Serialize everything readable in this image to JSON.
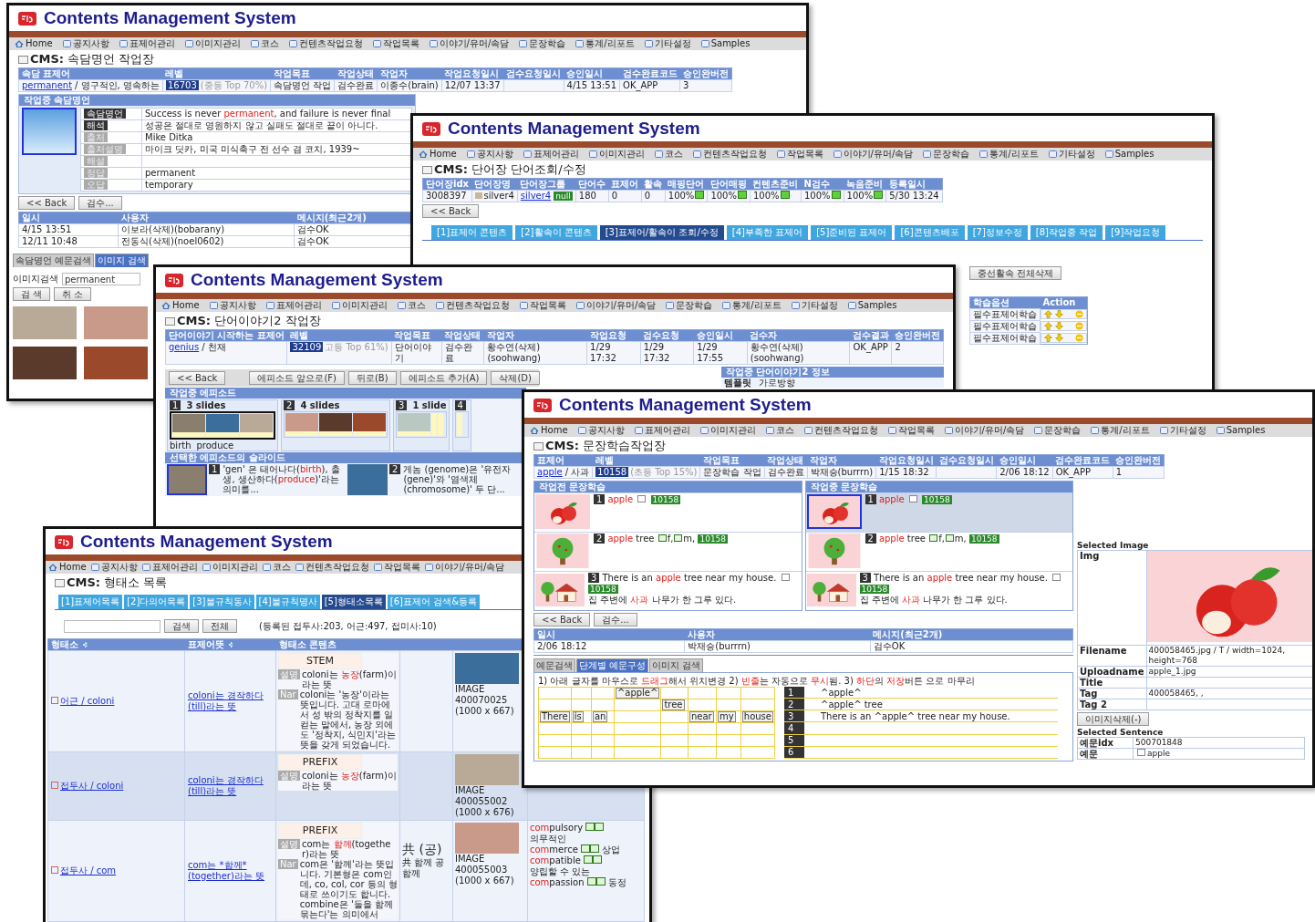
{
  "windows": [
    {
      "kind": "proverb",
      "title": "Contents Management System",
      "nav": [
        "Home",
        "공지사항",
        "표제어관리",
        "이미지관리",
        "코스",
        "컨텐츠작업요청",
        "작업목록",
        "이야기/유머/속담",
        "문장학습",
        "통계/리포트",
        "기타설정",
        "Samples"
      ],
      "page_title": "**CMS:** 속담명언 작업장",
      "summary": {
        "columns": [
          "속담 표제어",
          "레벨",
          "작업목표",
          "작업상태",
          "작업자",
          "작업요청일시",
          "검수요청일시",
          "승인일시",
          "검수완료코드",
          "승인완버전"
        ],
        "row": {
          "link": "permanent",
          "meaning": "/ 영구적인, 영속하는",
          "badge": "16703",
          "note": "(중등 Top 70%)",
          "cells": [
            "속담명언 작업",
            "검수완료",
            "이종수(brain)",
            "12/07 13:37",
            {
              "kind": "blank"
            },
            "4/15 13:51",
            "OK_APP",
            "3"
          ]
        }
      },
      "panel": {
        "header": "작업중 속담명언",
        "fields": [
          {
            "label": "속담명언",
            "active": true,
            "value": [
              {
                "text": "Success is never ",
                "red": false
              },
              {
                "text": "permanent",
                "red": true
              },
              {
                "text": ", and failure is never final",
                "red": false
              }
            ]
          },
          {
            "label": "해석",
            "active": true,
            "value": [
              {
                "text": "성공은 절대로 영원하지 않고 실패도 절대로 끝이 아니다.",
                "red": false
              }
            ]
          },
          {
            "label": "출처",
            "active": false,
            "value": [
              {
                "text": "Mike Ditka",
                "red": false
              }
            ]
          },
          {
            "label": "출처설명",
            "active": false,
            "value": [
              {
                "text": "마이크 딧카, 미국 미식축구 전 선수 겸 코치, 1939~",
                "red": false
              }
            ]
          },
          {
            "label": "해설",
            "active": false
          },
          {
            "label": "정답",
            "active": false,
            "value": [
              {
                "text": "permanent",
                "red": false
              }
            ]
          },
          {
            "label": "오답",
            "active": false,
            "value": [
              {
                "text": "temporary",
                "red": false
              }
            ]
          }
        ]
      },
      "buttons": [
        "<< Back",
        "검수..."
      ],
      "log": {
        "columns": [
          "일시",
          "사용자",
          "메시지(최근2개)"
        ],
        "rows": [
          [
            "4/15 13:51",
            "이보라(삭제)(bobarany)",
            "검수OK"
          ],
          [
            "12/11 10:48",
            "전동식(삭제)(noel0602)",
            "검수OK"
          ]
        ]
      },
      "tabs": [
        {
          "label": "속담명언 예문검색",
          "selected": false
        },
        {
          "label": "이미지 검색",
          "selected": true
        }
      ],
      "image_search": {
        "label": "이미지검색",
        "value": "permanent",
        "buttons": [
          "검 색",
          "취 소"
        ]
      }
    },
    {
      "kind": "wordbook",
      "title": "Contents Management System",
      "nav": [
        "Home",
        "공지사항",
        "표제어관리",
        "이미지관리",
        "코스",
        "컨텐츠작업요청",
        "작업목록",
        "이야기/유머/속담",
        "문장학습",
        "통계/리포트",
        "기타설정",
        "Samples"
      ],
      "page_title": "**CMS:** 단어장 단어조회/수정",
      "table": {
        "columns": [
          "단어장idx",
          "단어장명",
          "단어장그룹",
          "단어수",
          "표제어",
          "활속",
          "매핑단어",
          "단어매핑",
          "컨텐츠준비",
          "N검수",
          "녹음준비",
          "등록일시"
        ],
        "row": {
          "idx": "3008397",
          "name": "silver4",
          "group": "silver4",
          "group_tag": "null",
          "cells": [
            "180",
            "0",
            "0"
          ],
          "percents": [
            "100%",
            "100%",
            "100%",
            "100%",
            "100%"
          ],
          "date": "5/30 13:24"
        }
      },
      "back": "<< Back",
      "tabs": [
        {
          "label": "[1]표제어 콘텐츠",
          "selected": false
        },
        {
          "label": "[2]활속이 콘텐츠",
          "selected": false
        },
        {
          "label": "[3]표제어/활속이 조회/수정",
          "selected": true
        },
        {
          "label": "[4]부족한 표제어",
          "selected": false
        },
        {
          "label": "[5]준비된 표제어",
          "selected": false
        },
        {
          "label": "[6]콘텐츠배포",
          "selected": false
        },
        {
          "label": "[7]정보수정",
          "selected": false
        },
        {
          "label": "[8]작업중 작업",
          "selected": false
        },
        {
          "label": "[9]작업요청",
          "selected": false
        }
      ],
      "extra_button": "중선활속 전체삭제",
      "options": {
        "columns": [
          "학습옵션",
          "Action"
        ],
        "rows": [
          "필수표제어학습",
          "필수표제어학습",
          "필수표제어학습"
        ]
      }
    },
    {
      "kind": "story",
      "title": "Contents Management System",
      "nav": [
        "Home",
        "공지사항",
        "표제어관리",
        "이미지관리",
        "코스",
        "컨텐츠작업요청",
        "작업목록",
        "이야기/유머/속담",
        "문장학습",
        "통계/리포트",
        "기타설정",
        "Samples"
      ],
      "page_title": "**CMS:** 단어이야기2 작업장",
      "summary": {
        "columns": [
          "단어이야기 시작하는 표제어",
          "레벨",
          "작업목표",
          "작업상태",
          "작업자",
          "작업요청",
          "검수요청",
          "승인일시",
          "검수자",
          "검수결과",
          "승인완버전"
        ],
        "row": {
          "link": "genius",
          "meaning": "/ 천재",
          "badge": "32109",
          "note": "고등 Top 61%)",
          "cells": [
            "단어이야기",
            "검수완료",
            "황수연(삭제)(soohwang)",
            "1/29 17:32",
            "1/29 17:32",
            "1/29 17:55",
            "황수연(삭제)(soohwang)",
            "OK_APP",
            "2"
          ]
        }
      },
      "toolbar": [
        "<< Back",
        "에피소드 앞으로(F)",
        "뒤로(B)",
        "에피소드 추가(A)",
        "삭제(D)"
      ],
      "info": {
        "header": "작업중 단어이야기2 정보",
        "label": "템플릿",
        "value": "가로방향"
      },
      "episodes_header": "작업중 에피소드",
      "episodes": [
        {
          "num": "1",
          "count": "3 slides",
          "selected": true,
          "slides": [
            {
              "kind": "photo"
            },
            {
              "kind": "photo"
            },
            {
              "kind": "photo"
            }
          ],
          "words": [
            "birth",
            "produce"
          ]
        },
        {
          "num": "2",
          "count": "4 slides",
          "selected": false,
          "slides": [
            {
              "kind": "photo"
            },
            {
              "kind": "photo"
            },
            {
              "kind": "photo"
            }
          ]
        },
        {
          "num": "3",
          "count": "1 slide",
          "selected": false,
          "slides": [
            {
              "kind": "photo"
            },
            {
              "kind": "blank"
            },
            {
              "kind": "blank"
            }
          ]
        },
        {
          "num": "4",
          "selected": false,
          "slides": [
            {
              "kind": "blank"
            }
          ]
        }
      ],
      "slides_header": "선택한 에피소드의 슬라이드",
      "slides": [
        {
          "num": "1",
          "parts": [
            {
              "text": "'gen' 은 태어나다(",
              "red": false
            },
            {
              "text": "birth",
              "red": true
            },
            {
              "text": "), 출생, 생산하다(",
              "red": false
            },
            {
              "text": "produce",
              "red": true
            },
            {
              "text": ")'라는 의미를...",
              "red": false
            }
          ]
        },
        {
          "num": "2",
          "parts": [
            {
              "text": "게놈 (genome)은 '유전자(gene)'와 '염색체(chromosome)' 두 단...",
              "red": false
            }
          ]
        }
      ]
    },
    {
      "kind": "sentence",
      "title": "Contents Management System",
      "nav": [
        "Home",
        "공지사항",
        "표제어관리",
        "이미지관리",
        "코스",
        "컨텐츠작업요청",
        "작업목록",
        "이야기/유머/속담",
        "문장학습",
        "통계/리포트",
        "기타설정",
        "Samples"
      ],
      "page_title": "**CMS:** 문장학습작업장",
      "summary": {
        "columns": [
          "표제어",
          "레벨",
          "작업목표",
          "작업상태",
          "작업자",
          "작업요청일시",
          "검수요청일시",
          "승인일시",
          "검수완료코드",
          "승인완버전"
        ],
        "row": {
          "link": "apple",
          "meaning": "/ 사과",
          "badge": "10158",
          "note": "(초등 Top 15%)",
          "cells": [
            "문장학습 작업",
            "검수완료",
            "박재승(burrrn)",
            "1/15 18:32",
            {
              "kind": "blank"
            },
            "2/06 18:12",
            "OK_APP",
            "1"
          ]
        }
      },
      "panels": [
        {
          "header": "작업전 문장학습",
          "items": [
            {
              "num": "1",
              "picture": {
                "kind": "apple"
              },
              "kind": "image",
              "en": [
                {
                  "text": "apple",
                  "red": true
                }
              ],
              "grade": "10158",
              "selected": false
            },
            {
              "num": "2",
              "picture": {
                "kind": "tree"
              },
              "kind": "audio",
              "en": [
                {
                  "text": "apple",
                  "red": true
                },
                {
                  "text": " tree",
                  "red": false
                }
              ],
              "audio": [
                "f,",
                "m,"
              ],
              "grade": "10158",
              "selected": false
            },
            {
              "num": "3",
              "picture": {
                "kind": "house"
              },
              "kind": "image",
              "en": [
                {
                  "text": "There is an ",
                  "red": false
                },
                {
                  "text": "apple",
                  "red": true
                },
                {
                  "text": " tree near my house.",
                  "red": false
                }
              ],
              "ko": [
                {
                  "text": "집 주변에 ",
                  "red": false
                },
                {
                  "text": "사과",
                  "red": true
                },
                {
                  "text": " 나무가 한 그루 있다.",
                  "red": false
                }
              ],
              "grade": "10158",
              "selected": false
            }
          ]
        },
        {
          "header": "작업중 문장학습",
          "items": [
            {
              "num": "1",
              "picture": {
                "kind": "apple"
              },
              "kind": "image",
              "en": [
                {
                  "text": "apple",
                  "red": true
                }
              ],
              "grade": "10158",
              "selected": true
            },
            {
              "num": "2",
              "picture": {
                "kind": "tree"
              },
              "kind": "audio",
              "en": [
                {
                  "text": "apple",
                  "red": true
                },
                {
                  "text": " tree",
                  "red": false
                }
              ],
              "audio": [
                "f,",
                "m,"
              ],
              "grade": "10158",
              "selected": false
            },
            {
              "num": "3",
              "picture": {
                "kind": "house"
              },
              "kind": "image",
              "en": [
                {
                  "text": "There is an ",
                  "red": false
                },
                {
                  "text": "apple",
                  "red": true
                },
                {
                  "text": " tree near my house.",
                  "red": false
                }
              ],
              "ko": [
                {
                  "text": "집 주변에 ",
                  "red": false
                },
                {
                  "text": "사과",
                  "red": true
                },
                {
                  "text": " 나무가 한 그루 있다.",
                  "red": false
                }
              ],
              "grade": "10158",
              "selected": false
            }
          ]
        }
      ],
      "buttons": [
        "<< Back",
        "검수..."
      ],
      "log": {
        "columns": [
          "일시",
          "사용자",
          "메시지(최근2개)"
        ],
        "rows": [
          [
            "2/06 18:12",
            "박재승(burrrn)",
            "검수OK"
          ]
        ]
      },
      "tabs": [
        {
          "label": "예문검색",
          "selected": false
        },
        {
          "label": "단계별 예문구성",
          "selected": true
        },
        {
          "label": "이미지 검색",
          "selected": false
        }
      ],
      "instruction": [
        {
          "text": "1) 아래 글자를 마우스로 ",
          "red": false
        },
        {
          "text": "드래그",
          "red": true
        },
        {
          "text": "해서 위치변경    2) ",
          "red": false
        },
        {
          "text": "빈줄",
          "red": true
        },
        {
          "text": "는 자동으로 ",
          "red": false
        },
        {
          "text": "무시",
          "red": true
        },
        {
          "text": "됨.    3) ",
          "red": false
        },
        {
          "text": "하단",
          "red": true
        },
        {
          "text": "의 ",
          "red": false
        },
        {
          "text": "저장",
          "red": true
        },
        {
          "text": "버튼 으로 마무리",
          "red": false
        }
      ],
      "grid": [
        [
          {
            "kind": "empty"
          },
          {
            "kind": "empty"
          },
          {
            "kind": "empty"
          },
          {
            "kind": "word",
            "word": "^apple^"
          },
          {
            "kind": "empty"
          },
          {
            "kind": "empty"
          },
          {
            "kind": "empty"
          },
          {
            "kind": "empty"
          }
        ],
        [
          {
            "kind": "empty"
          },
          {
            "kind": "empty"
          },
          {
            "kind": "empty"
          },
          {
            "kind": "empty"
          },
          {
            "kind": "word",
            "word": "tree"
          },
          {
            "kind": "empty"
          },
          {
            "kind": "empty"
          },
          {
            "kind": "empty"
          }
        ],
        [
          {
            "kind": "word",
            "word": "There"
          },
          {
            "kind": "word",
            "word": "is"
          },
          {
            "kind": "word",
            "word": "an"
          },
          {
            "kind": "empty"
          },
          {
            "kind": "empty"
          },
          {
            "kind": "word",
            "word": "near"
          },
          {
            "kind": "word",
            "word": "my"
          },
          {
            "kind": "word",
            "word": "house"
          }
        ],
        [
          {
            "kind": "empty"
          },
          {
            "kind": "empty"
          },
          {
            "kind": "empty"
          },
          {
            "kind": "empty"
          },
          {
            "kind": "empty"
          },
          {
            "kind": "empty"
          },
          {
            "kind": "empty"
          },
          {
            "kind": "empty"
          }
        ],
        [
          {
            "kind": "empty"
          },
          {
            "kind": "empty"
          },
          {
            "kind": "empty"
          },
          {
            "kind": "empty"
          },
          {
            "kind": "empty"
          },
          {
            "kind": "empty"
          },
          {
            "kind": "empty"
          },
          {
            "kind": "empty"
          }
        ],
        [
          {
            "kind": "empty"
          },
          {
            "kind": "empty"
          },
          {
            "kind": "empty"
          },
          {
            "kind": "empty"
          },
          {
            "kind": "empty"
          },
          {
            "kind": "empty"
          },
          {
            "kind": "empty"
          },
          {
            "kind": "empty"
          }
        ]
      ],
      "sentences": [
        {
          "num": "1",
          "text": "^apple^"
        },
        {
          "num": "2",
          "text": "^apple^ tree"
        },
        {
          "num": "3",
          "text": "There is an ^apple^ tree near my house."
        },
        {
          "num": "4"
        },
        {
          "num": "5"
        },
        {
          "num": "6"
        }
      ],
      "selected_image": {
        "title": "Selected Image",
        "img_label": "Img",
        "fields": [
          {
            "label": "Filename",
            "value": "400058465.jpg / T / width=1024, height=768"
          },
          {
            "label": "Uploadname",
            "value": "apple_1.jpg"
          },
          {
            "label": "Title"
          },
          {
            "label": "Tag",
            "value": "400058465, ,"
          },
          {
            "label": "Tag 2"
          }
        ],
        "button": "이미지삭제(-)"
      },
      "selected_sentence": {
        "title": "Selected Sentence",
        "fields": [
          {
            "label": "예문idx",
            "value": "500701848"
          },
          {
            "label": "예문",
            "value": "apple"
          }
        ]
      }
    },
    {
      "kind": "morpheme",
      "title": "Contents Management System",
      "nav": [
        "Home",
        "공지사항",
        "표제어관리",
        "이미지관리",
        "코스",
        "컨텐츠작업요청",
        "작업목록",
        "이야기/유머/속담"
      ],
      "page_title": "**CMS:** 형태소 목록",
      "tabs": [
        {
          "label": "[1]표제어목록",
          "selected": false
        },
        {
          "label": "[2]다의어목록",
          "selected": false
        },
        {
          "label": "[3]불규칙동사",
          "selected": false
        },
        {
          "label": "[4]불규칙명사",
          "selected": false
        },
        {
          "label": "[5]형태소목록",
          "selected": true
        },
        {
          "label": "[6]표제어 검색&등록",
          "selected": false
        }
      ],
      "search": {
        "buttons": [
          "검색",
          "전체"
        ],
        "stats": "(등록된 접두사:203, 어근:497, 접미사:10)"
      },
      "table": {
        "columns": [
          "형태소",
          "표제어뜻",
          "형태소 콘텐츠"
        ],
        "rows": [
          {
            "morpheme": "어근 / coloni",
            "meaning": "coloni는 경작하다(till)라는 뜻",
            "type": "STEM",
            "desc_label": "설명",
            "desc": [
              {
                "text": "coloni는 ",
                "red": false
              },
              {
                "text": "농장",
                "red": true
              },
              {
                "text": "(farm)이라는 뜻",
                "red": false
              }
            ],
            "nar_label": "Nar",
            "nar": "coloni는 '농장'이라는 뜻입니다. 고대 로마에서 성 밖의 정착지를 일컫는 말에서, 농장 외에도 '정착지, 식민지'라는 뜻을 갖게 되었습니다.",
            "image": [
              "IMAGE",
              "400070025",
              "(1000 x 667)"
            ],
            "selected": false
          },
          {
            "morpheme": "접두사 / coloni",
            "meaning": "coloni는 경작하다(till)라는 뜻",
            "type": "PREFIX",
            "desc_label": "설명",
            "desc": [
              {
                "text": "coloni는 ",
                "red": false
              },
              {
                "text": "농장",
                "red": true
              },
              {
                "text": "(farm)이라는 뜻",
                "red": false
              }
            ],
            "image": [
              "IMAGE",
              "400055002",
              "(1000 x 676)"
            ],
            "selected": true
          },
          {
            "morpheme": "접두사 / com",
            "meaning": "com는 *함께*(together)라는 뜻",
            "type": "PREFIX",
            "desc_label": "설명",
            "desc": [
              {
                "text": "com는 ",
                "red": false
              },
              {
                "text": "함께",
                "red": true
              },
              {
                "text": "(together)라는 뜻",
                "red": false
              }
            ],
            "nar_label": "Nar",
            "nar": "com은 '함께'라는 뜻입니다. 기본형은 com인데, co, col, cor 등의 형태로 쓰이기도 합니다. combine은 '둘을 함께 묶는다'는 의미에서",
            "hanja": [
              "共 (공)",
              "共 함께 공 함께"
            ],
            "image": [
              "IMAGE",
              "400055003",
              "(1000 x 667)"
            ],
            "related": [
              {
                "red": "com",
                "rest": "pulsory",
                "meaning": "의무적인"
              },
              {
                "red": "com",
                "rest": "merce",
                "meaning": "상업"
              },
              {
                "red": "com",
                "rest": "patible",
                "meaning": "양립할 수 있는"
              },
              {
                "red": "com",
                "rest": "passion",
                "meaning": "동정"
              }
            ],
            "selected": false
          }
        ]
      }
    }
  ]
}
